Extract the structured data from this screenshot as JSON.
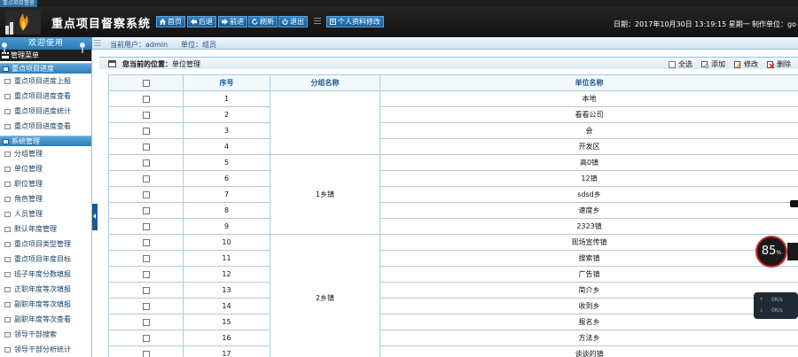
{
  "window": {
    "tag": "重点项目督查"
  },
  "header": {
    "title": "重点项目督察系统",
    "nav": [
      {
        "label": "首页",
        "icon": "home-icon"
      },
      {
        "label": "后退",
        "icon": "back-arrow-icon"
      },
      {
        "label": "前进",
        "icon": "forward-arrow-icon"
      },
      {
        "label": "刷新",
        "icon": "refresh-icon"
      },
      {
        "label": "退出",
        "icon": "power-icon"
      },
      {
        "label": "个人资料修改",
        "icon": "profile-icon"
      }
    ],
    "date": "日期：2017年10月30日 13:19:15 星期一",
    "org": "制作单位：go"
  },
  "subbar": {
    "welcome": "欢迎使用",
    "user": "当前用户：admin",
    "position": "单位：组员"
  },
  "sidebar": {
    "menu_title": "管理菜单",
    "groups": [
      {
        "title": "重点项目进度",
        "items": [
          "重点项目进度上报",
          "重点项目进度查看",
          "重点项目进度统计",
          "重点项目进度查看"
        ]
      },
      {
        "title": "系统管理",
        "items": [
          "分组管理",
          "单位管理",
          "职位管理",
          "角色管理",
          "人员管理",
          "默认年度管理",
          "重点项目类型管理",
          "重点项目年度目标",
          "班子年度分数填报",
          "正职年度等次填报",
          "副职年度等次填报",
          "副职年度等次查看",
          "领导干部搜索",
          "领导干部分析统计"
        ]
      }
    ]
  },
  "main": {
    "location_label": "您当前的位置：",
    "location_value": "单位管理",
    "tools": [
      {
        "label": "全选",
        "icon": "checkbox-icon"
      },
      {
        "label": "添加",
        "icon": "add-icon"
      },
      {
        "label": "修改",
        "icon": "edit-icon"
      },
      {
        "label": "删除",
        "icon": "delete-icon"
      }
    ],
    "table": {
      "headers": [
        "",
        "序号",
        "分组名称",
        "单位名称"
      ],
      "rows": [
        {
          "no": "1",
          "unit": "本地"
        },
        {
          "no": "2",
          "unit": "看看公司"
        },
        {
          "no": "3",
          "unit": "会"
        },
        {
          "no": "4",
          "unit": "开发区"
        },
        {
          "no": "5",
          "unit": "高0镇"
        },
        {
          "no": "6",
          "unit": "12镇"
        },
        {
          "no": "7",
          "unit": "sdsd乡"
        },
        {
          "no": "8",
          "unit": "速度乡"
        },
        {
          "no": "9",
          "unit": "2323镇"
        },
        {
          "no": "10",
          "unit": "现场宣传镇"
        },
        {
          "no": "11",
          "unit": "搜索镇"
        },
        {
          "no": "12",
          "unit": "广告镇"
        },
        {
          "no": "13",
          "unit": "简介乡"
        },
        {
          "no": "14",
          "unit": "收到乡"
        },
        {
          "no": "15",
          "unit": "报名乡"
        },
        {
          "no": "16",
          "unit": "方法乡"
        },
        {
          "no": "17",
          "unit": "谈谈的镇"
        }
      ],
      "groups": [
        {
          "label": "",
          "span": 4
        },
        {
          "label": "1乡镇",
          "span": 5
        },
        {
          "label": "2乡镇",
          "span": 8
        }
      ]
    }
  },
  "widget": {
    "percent": "85",
    "percent_unit": "%",
    "up": "0K/s",
    "down": "0K/s"
  },
  "colors": {
    "accent": "#2f7cb5",
    "header": "#1a1a1a",
    "grid": "#a9cbe3"
  }
}
